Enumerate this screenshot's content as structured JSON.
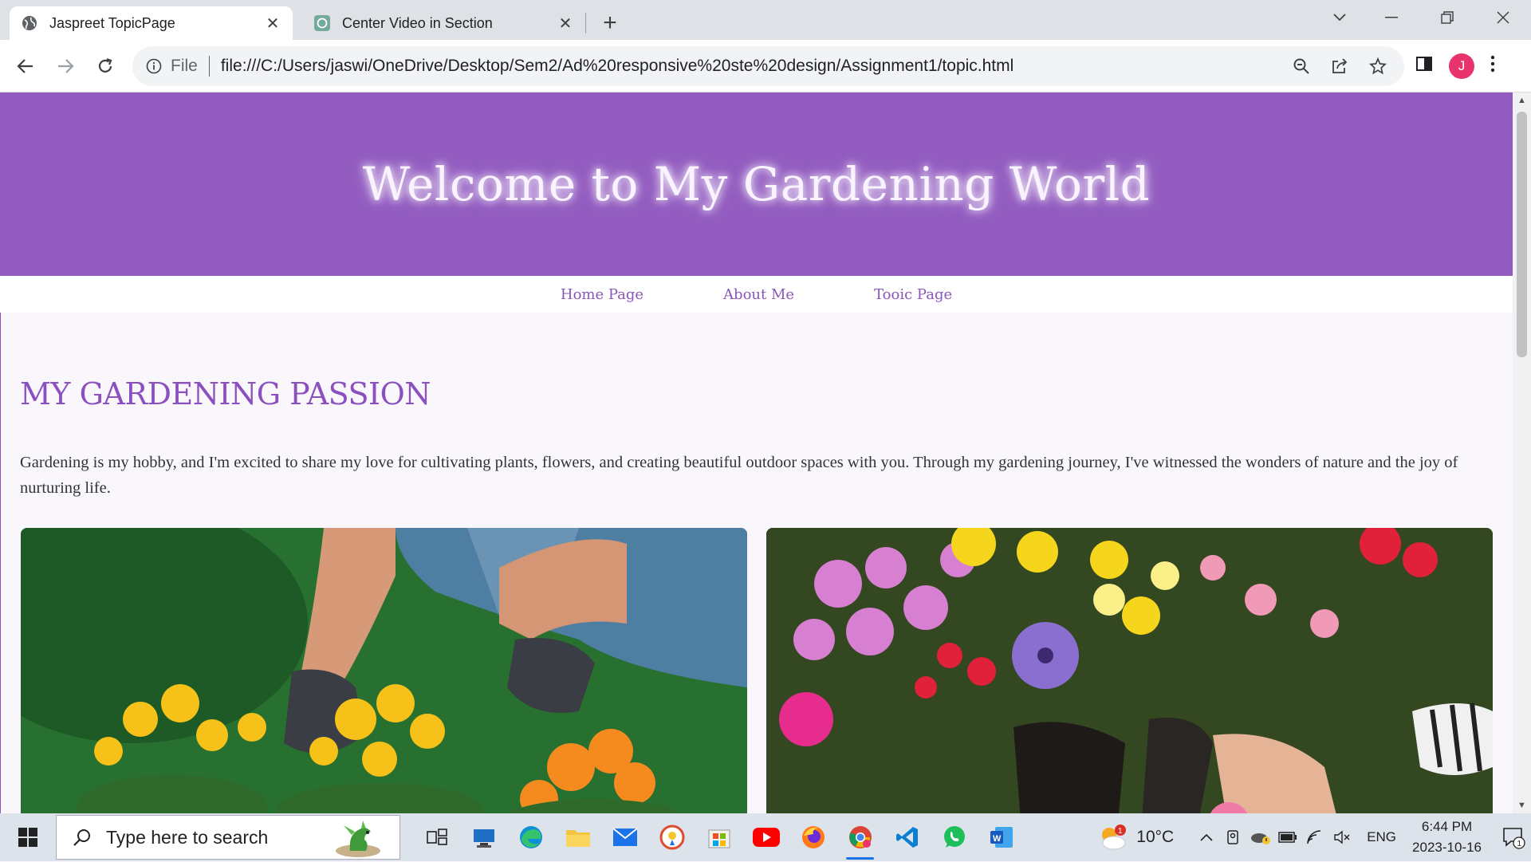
{
  "browser": {
    "tabs": [
      {
        "title": "Jaspreet TopicPage",
        "active": true
      },
      {
        "title": "Center Video in Section",
        "active": false
      }
    ],
    "omnibox": {
      "scheme_label": "File",
      "url": "file:///C:/Users/jaswi/OneDrive/Desktop/Sem2/Ad%20responsive%20ste%20design/Assignment1/topic.html"
    },
    "profile_initial": "J"
  },
  "page": {
    "hero_title": "Welcome to My Gardening World",
    "nav": [
      "Home Page",
      "About Me",
      "Tooic Page"
    ],
    "heading": "MY GARDENING PASSION",
    "paragraph": "Gardening is my hobby, and I'm excited to share my love for cultivating plants, flowers, and creating beautiful outdoor spaces with you. Through my gardening journey, I've witnessed the wonders of nature and the joy of nurturing life.",
    "colors": {
      "header_bg": "#925bc0",
      "accent": "#8b4fbf"
    }
  },
  "taskbar": {
    "search_placeholder": "Type here to search",
    "weather": "10°C",
    "weather_badge": "1",
    "language": "ENG",
    "time": "6:44 PM",
    "date": "2023-10-16",
    "notification_count": "1"
  }
}
